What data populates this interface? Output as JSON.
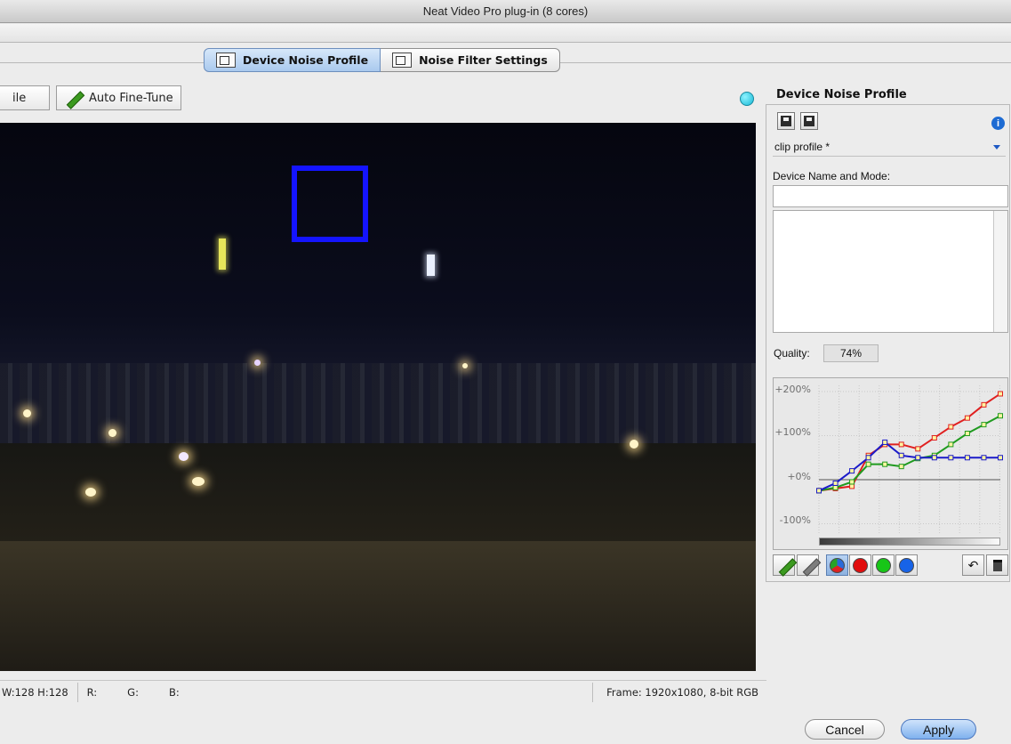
{
  "window": {
    "title": "Neat Video Pro plug-in (8 cores)"
  },
  "tabs": [
    {
      "label": "Device Noise Profile",
      "icon": "camera-icon",
      "active": true
    },
    {
      "label": "Noise Filter Settings",
      "icon": "sliders-icon",
      "active": false
    }
  ],
  "toolbar": {
    "file_partial_label": "ile",
    "auto_fine_tune_label": "Auto Fine-Tune"
  },
  "statusbar": {
    "size": "W:128 H:128",
    "r_label": "R:",
    "g_label": "G:",
    "b_label": "B:",
    "frame": "Frame: 1920x1080, 8-bit RGB"
  },
  "panel": {
    "title": "Device Noise Profile",
    "profile_combo_value": "clip profile *",
    "device_name_label": "Device Name and Mode:",
    "device_name_value": "",
    "quality_label": "Quality:",
    "quality_value": "74%",
    "graph": {
      "y_ticks": [
        "+200%",
        "+100%",
        "+0%",
        "-100%"
      ],
      "series": [
        {
          "name": "red",
          "color": "#e02020",
          "values": [
            -25,
            -20,
            -15,
            55,
            80,
            80,
            70,
            95,
            120,
            140,
            170,
            195
          ]
        },
        {
          "name": "green",
          "color": "#1f9a1f",
          "values": [
            -25,
            -18,
            -5,
            35,
            35,
            30,
            48,
            55,
            80,
            105,
            125,
            145
          ]
        },
        {
          "name": "blue",
          "color": "#1b1bc9",
          "values": [
            -25,
            -8,
            20,
            50,
            85,
            55,
            50,
            50,
            50,
            50,
            50,
            50
          ]
        }
      ]
    }
  },
  "buttons": {
    "cancel": "Cancel",
    "apply": "Apply"
  },
  "colors": {
    "active_tab": "#a9c9ee",
    "roi_box": "#1414ff",
    "status_dot": "#15b8d5",
    "apply_button": "#7fb1ee"
  }
}
